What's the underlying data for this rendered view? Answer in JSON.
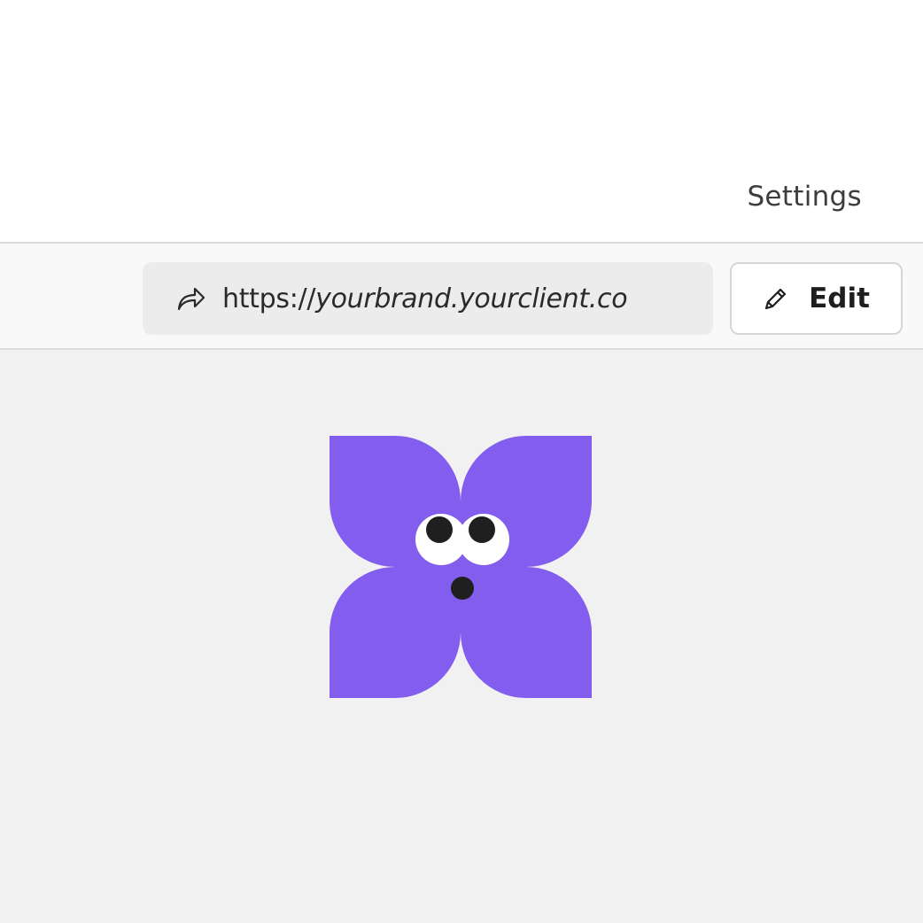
{
  "header": {
    "settings_label": "Settings"
  },
  "toolbar": {
    "url_prefix": "https://",
    "url_domain": "yourbrand.yourclient.co",
    "share_icon": "share-arrow-icon",
    "edit_icon": "pencil-icon",
    "edit_label": "Edit"
  },
  "preview": {
    "logo_icon": "purple-flower-face-logo"
  },
  "colors": {
    "brand_purple": "#825DEE",
    "canvas_bg": "#F2F1F2",
    "toolbar_bg": "#F9F9F9",
    "url_box_bg": "#ECECEC",
    "eye_white": "#FFFFFF",
    "pupil": "#1F1F1F"
  }
}
